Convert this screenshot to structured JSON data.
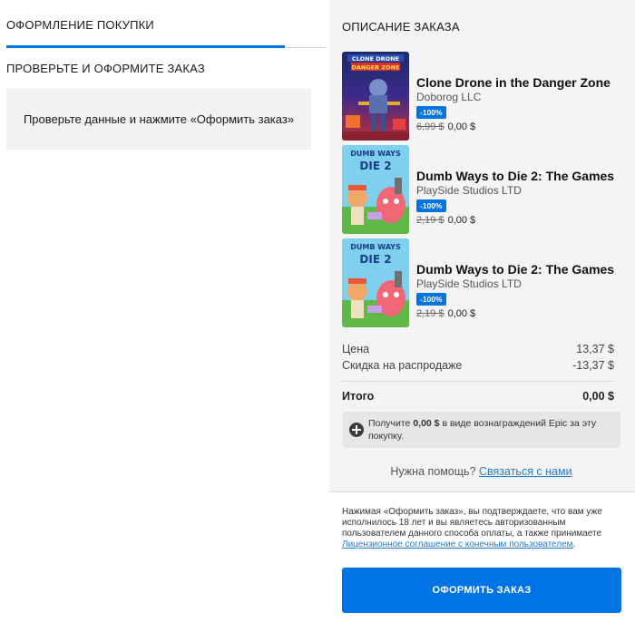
{
  "left": {
    "tab_label": "ОФОРМЛЕНИЕ ПОКУПКИ",
    "section_title": "ПРОВЕРЬТЕ И ОФОРМИТЕ ЗАКАЗ",
    "info_text": "Проверьте данные и нажмите «Оформить заказ»"
  },
  "summary": {
    "title": "ОПИСАНИЕ ЗАКАЗА",
    "items": [
      {
        "title": "Clone Drone in the Danger Zone",
        "developer": "Doborog LLC",
        "discount": "-100%",
        "old_price": "6,99 $",
        "new_price": "0,00 $",
        "cover_text_1": "CLONE DRONE",
        "cover_text_2": "DANGER ZONE"
      },
      {
        "title": "Dumb Ways to Die 2: The Games",
        "developer": "PlaySide Studios LTD",
        "discount": "-100%",
        "old_price": "2,19 $",
        "new_price": "0,00 $",
        "cover_text_1": "DUMB WAYS",
        "cover_text_2": "DIE 2"
      },
      {
        "title": "Dumb Ways to Die 2: The Games",
        "developer": "PlaySide Studios LTD",
        "discount": "-100%",
        "old_price": "2,19 $",
        "new_price": "0,00 $",
        "cover_text_1": "DUMB WAYS",
        "cover_text_2": "DIE 2"
      }
    ],
    "price_label": "Цена",
    "price_value": "13,37 $",
    "sale_label": "Скидка на распродаже",
    "sale_value": "-13,37 $",
    "total_label": "Итого",
    "total_value": "0,00 $",
    "reward_prefix": "Получите ",
    "reward_amount": "0,00 $",
    "reward_suffix": " в виде вознаграждений Epic за эту покупку.",
    "help_text": "Нужна помощь? ",
    "help_link": "Связаться с нами"
  },
  "footer": {
    "legal_text": "Нажимая «Оформить заказ», вы подтверждаете, что вам уже исполнилось 18 лет и вы являетесь авторизованным пользователем данного способа оплаты, а также принимаете ",
    "legal_link": "Лицензионное соглашение с конечным пользователем",
    "legal_end": ".",
    "order_button": "ОФОРМИТЬ ЗАКАЗ"
  },
  "colors": {
    "accent": "#0074e4",
    "link": "#2a7ac7",
    "panel": "#f4f4f4"
  }
}
